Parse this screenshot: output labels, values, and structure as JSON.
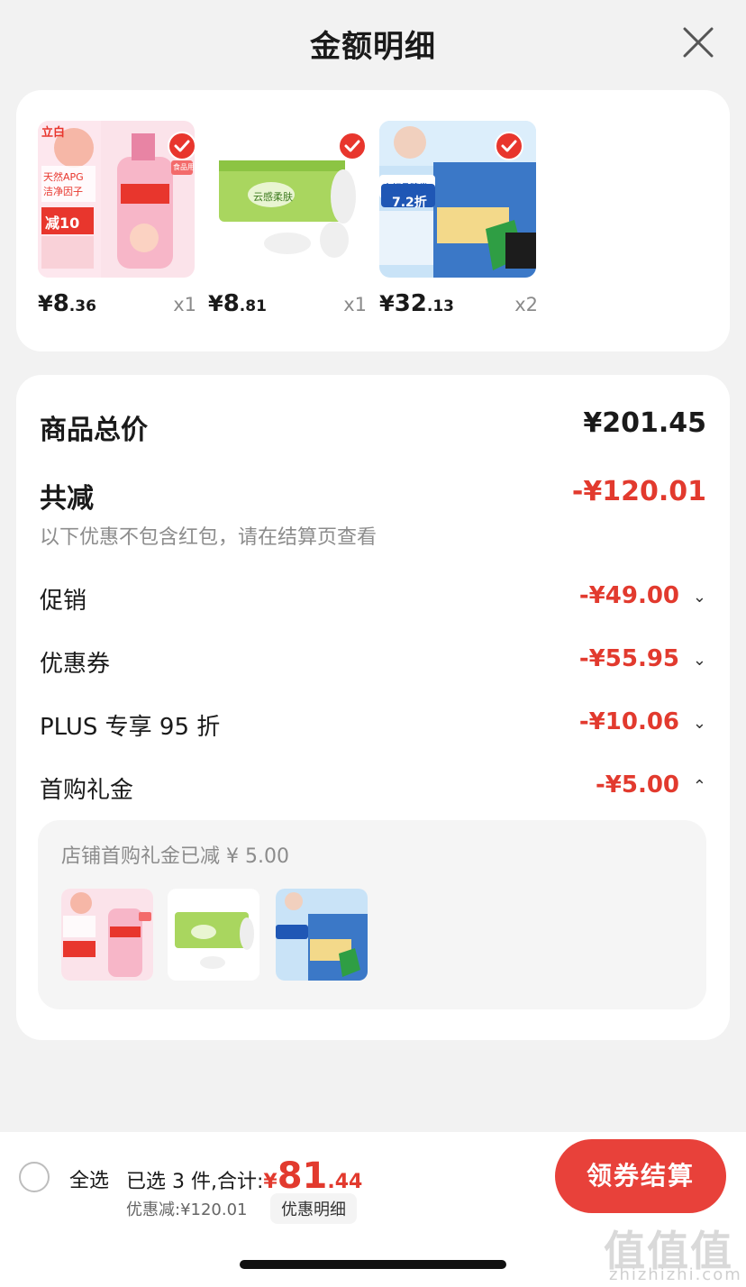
{
  "header": {
    "title": "金额明细"
  },
  "products": [
    {
      "price_int": "8",
      "price_dec": ".36",
      "qty": "x1",
      "img_text_1": "天然APG",
      "img_text_2": "洁净因子",
      "img_text_3": "减10",
      "img_text_4": "食品用",
      "brand": "立白"
    },
    {
      "price_int": "8",
      "price_dec": ".81",
      "qty": "x1",
      "img_text_1": "云感柔肤"
    },
    {
      "price_int": "32",
      "price_dec": ".13",
      "qty": "x2",
      "img_text_1": "大额品牌券",
      "img_text_2": "7.2折"
    }
  ],
  "currency": "¥",
  "summary": {
    "total_label": "商品总价",
    "total_value": "¥201.45",
    "reduce_label": "共减",
    "reduce_value": "-¥120.01",
    "note": "以下优惠不包含红包，请在结算页查看",
    "items": [
      {
        "label": "促销",
        "value": "-¥49.00",
        "chevron": "⌄"
      },
      {
        "label": "优惠券",
        "value": "-¥55.95",
        "chevron": "⌄"
      },
      {
        "label": "PLUS 专享 95 折",
        "value": "-¥10.06",
        "chevron": "⌄"
      },
      {
        "label": "首购礼金",
        "value": "-¥5.00",
        "chevron": "⌃"
      }
    ],
    "first_buy_note": "店铺首购礼金已减 ¥ 5.00"
  },
  "bottom": {
    "select_all": "全选",
    "selected_text": "已选 3 件,合计:",
    "total_yen": "¥",
    "total_int": "81",
    "total_dec": ".44",
    "discount_text": "优惠减:¥120.01",
    "discount_detail": "优惠明细",
    "settle_button": "领券结算"
  },
  "watermark": {
    "text": "值值值",
    "site": "zhizhizhi.com"
  },
  "colors": {
    "accent": "#e23a2e",
    "button": "#e8413a",
    "check": "#e8362d"
  }
}
